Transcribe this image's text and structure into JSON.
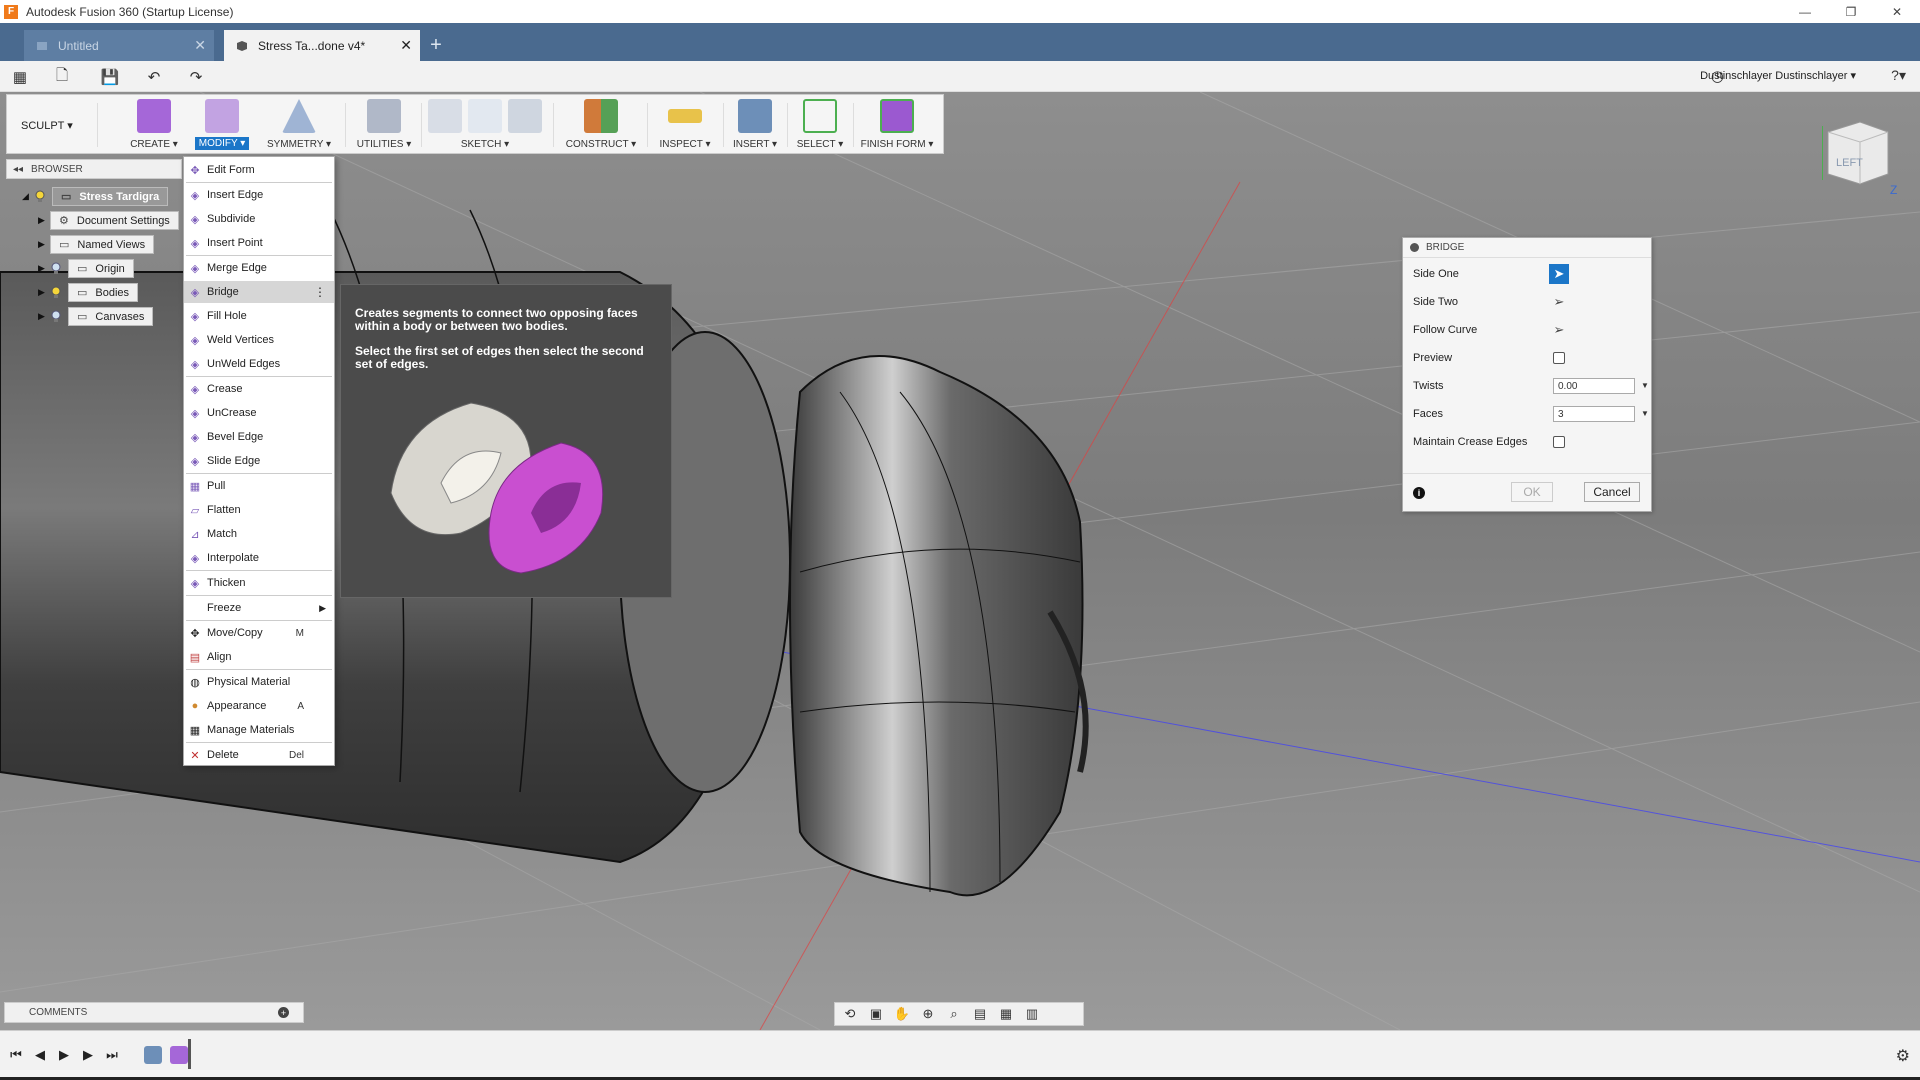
{
  "window": {
    "title": "Autodesk Fusion 360 (Startup License)",
    "controls": [
      "—",
      "❐",
      "✕"
    ]
  },
  "tabs": [
    {
      "label": "Untitled",
      "active": false
    },
    {
      "label": "Stress Ta...done v4*",
      "active": true
    }
  ],
  "tab_add": "+",
  "tab_close": "✕",
  "qat": {
    "user": "Dustinschlayer Dustinschlayer ▾",
    "help": "?▾"
  },
  "ribbon": {
    "workspace": "SCULPT ▾",
    "groups": [
      {
        "label": "CREATE ▾"
      },
      {
        "label": "MODIFY ▾"
      },
      {
        "label": "SYMMETRY ▾"
      },
      {
        "label": "UTILITIES ▾"
      },
      {
        "label": "SKETCH ▾"
      },
      {
        "label": "CONSTRUCT ▾"
      },
      {
        "label": "INSPECT ▾"
      },
      {
        "label": "INSERT ▾"
      },
      {
        "label": "SELECT ▾"
      },
      {
        "label": "FINISH FORM ▾"
      }
    ]
  },
  "browser": {
    "title": "BROWSER",
    "items": [
      {
        "label": "Stress Tardigra"
      },
      {
        "label": "Document Settings"
      },
      {
        "label": "Named Views"
      },
      {
        "label": "Origin"
      },
      {
        "label": "Bodies"
      },
      {
        "label": "Canvases"
      }
    ]
  },
  "modify_menu": {
    "items": [
      {
        "label": "Edit Form",
        "shortcut": ""
      },
      {
        "label": "Insert Edge",
        "shortcut": ""
      },
      {
        "label": "Subdivide",
        "shortcut": ""
      },
      {
        "label": "Insert Point",
        "shortcut": ""
      },
      {
        "label": "Merge Edge",
        "shortcut": ""
      },
      {
        "label": "Bridge",
        "shortcut": ""
      },
      {
        "label": "Fill Hole",
        "shortcut": ""
      },
      {
        "label": "Weld Vertices",
        "shortcut": ""
      },
      {
        "label": "UnWeld Edges",
        "shortcut": ""
      },
      {
        "label": "Crease",
        "shortcut": ""
      },
      {
        "label": "UnCrease",
        "shortcut": ""
      },
      {
        "label": "Bevel Edge",
        "shortcut": ""
      },
      {
        "label": "Slide Edge",
        "shortcut": ""
      },
      {
        "label": "Pull",
        "shortcut": ""
      },
      {
        "label": "Flatten",
        "shortcut": ""
      },
      {
        "label": "Match",
        "shortcut": ""
      },
      {
        "label": "Interpolate",
        "shortcut": ""
      },
      {
        "label": "Thicken",
        "shortcut": ""
      },
      {
        "label": "Freeze",
        "shortcut": ""
      },
      {
        "label": "Move/Copy",
        "shortcut": "M"
      },
      {
        "label": "Align",
        "shortcut": ""
      },
      {
        "label": "Physical Material",
        "shortcut": ""
      },
      {
        "label": "Appearance",
        "shortcut": "A"
      },
      {
        "label": "Manage Materials",
        "shortcut": ""
      },
      {
        "label": "Delete",
        "shortcut": "Del"
      }
    ],
    "more": "⋮",
    "submenu_arrow": "▶"
  },
  "tooltip": {
    "line1": "Creates segments to connect two opposing faces within a body or between two bodies.",
    "line2": "Select the first set of edges then select the second set of edges."
  },
  "bridge_dialog": {
    "title": "BRIDGE",
    "side_one": "Side One",
    "side_two": "Side Two",
    "follow_curve": "Follow Curve",
    "preview": "Preview",
    "twists_label": "Twists",
    "twists_value": "0.00",
    "faces_label": "Faces",
    "faces_value": "3",
    "maintain_crease": "Maintain Crease Edges",
    "info": "i",
    "ok": "OK",
    "cancel": "Cancel"
  },
  "viewcube": {
    "face": "LEFT",
    "axis": "Z"
  },
  "comments": {
    "label": "COMMENTS",
    "plus": "+"
  },
  "colors": {
    "accent": "#1b76c8",
    "tabbar": "#4a6a8f",
    "tooltip_bg": "#4b4b4b",
    "sculpt_purple": "#9b59d0",
    "body_magenta": "#c94fd0"
  }
}
